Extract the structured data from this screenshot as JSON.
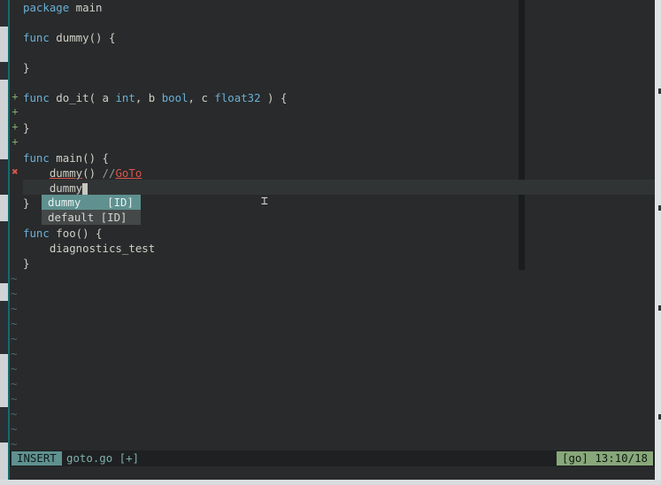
{
  "editor": {
    "lines": {
      "l1": {
        "kw": "package",
        "rest": " main"
      },
      "l3": {
        "kw": "func",
        "rest": " dummy() {"
      },
      "l5": {
        "text": "}"
      },
      "l7": {
        "kw": "func",
        "a": " do_it( a ",
        "t1": "int",
        "b": ", b ",
        "t2": "bool",
        "c": ", c ",
        "t3": "float32",
        "d": " ) {"
      },
      "l9": {
        "text": "}"
      },
      "l11": {
        "kw": "func",
        "rest": " main() {"
      },
      "l12": {
        "pre": "    ",
        "call": "dummy",
        "post": "() ",
        "cslash": "//",
        "ctext": "GoTo"
      },
      "l13": {
        "pre": "    ",
        "text": "dummy"
      },
      "l14": {
        "text": "}"
      },
      "l15": {
        "kw": "func",
        "rest": " foo() {"
      },
      "l16": {
        "text": "    diagnostics_test"
      },
      "l17": {
        "text": "}"
      }
    },
    "signs": {
      "plus": "+",
      "error": "✖"
    },
    "tilde": "~"
  },
  "completion": {
    "items": [
      {
        "label": "dummy    [ID]"
      },
      {
        "label": "default [ID]"
      }
    ]
  },
  "statusline": {
    "mode": "INSERT",
    "filename": "goto.go [+]",
    "position": "[go] 13:10/18"
  },
  "colors": {
    "keyword": "#6ab0d6",
    "error": "#d9564a",
    "mode_bg": "#5f9190",
    "position_bg": "#88a77a"
  }
}
